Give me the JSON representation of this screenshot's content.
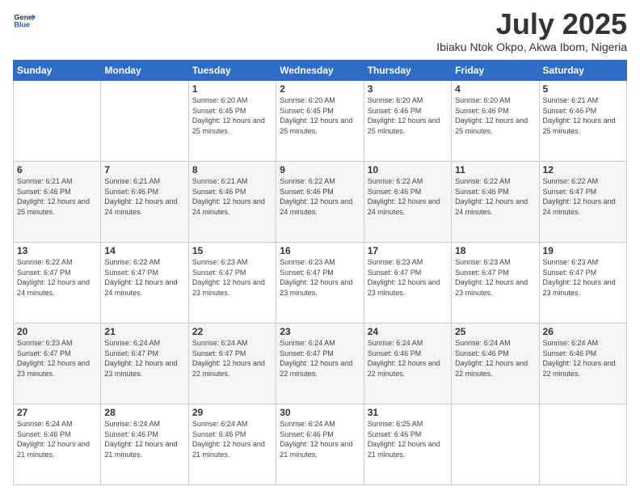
{
  "header": {
    "logo": {
      "general": "General",
      "blue": "Blue"
    },
    "title": "July 2025",
    "location": "Ibiaku Ntok Okpo, Akwa Ibom, Nigeria"
  },
  "weekdays": [
    "Sunday",
    "Monday",
    "Tuesday",
    "Wednesday",
    "Thursday",
    "Friday",
    "Saturday"
  ],
  "weeks": [
    [
      {
        "day": "",
        "info": ""
      },
      {
        "day": "",
        "info": ""
      },
      {
        "day": "1",
        "info": "Sunrise: 6:20 AM\nSunset: 6:45 PM\nDaylight: 12 hours and 25 minutes."
      },
      {
        "day": "2",
        "info": "Sunrise: 6:20 AM\nSunset: 6:45 PM\nDaylight: 12 hours and 25 minutes."
      },
      {
        "day": "3",
        "info": "Sunrise: 6:20 AM\nSunset: 6:46 PM\nDaylight: 12 hours and 25 minutes."
      },
      {
        "day": "4",
        "info": "Sunrise: 6:20 AM\nSunset: 6:46 PM\nDaylight: 12 hours and 25 minutes."
      },
      {
        "day": "5",
        "info": "Sunrise: 6:21 AM\nSunset: 6:46 PM\nDaylight: 12 hours and 25 minutes."
      }
    ],
    [
      {
        "day": "6",
        "info": "Sunrise: 6:21 AM\nSunset: 6:46 PM\nDaylight: 12 hours and 25 minutes."
      },
      {
        "day": "7",
        "info": "Sunrise: 6:21 AM\nSunset: 6:46 PM\nDaylight: 12 hours and 24 minutes."
      },
      {
        "day": "8",
        "info": "Sunrise: 6:21 AM\nSunset: 6:46 PM\nDaylight: 12 hours and 24 minutes."
      },
      {
        "day": "9",
        "info": "Sunrise: 6:22 AM\nSunset: 6:46 PM\nDaylight: 12 hours and 24 minutes."
      },
      {
        "day": "10",
        "info": "Sunrise: 6:22 AM\nSunset: 6:46 PM\nDaylight: 12 hours and 24 minutes."
      },
      {
        "day": "11",
        "info": "Sunrise: 6:22 AM\nSunset: 6:46 PM\nDaylight: 12 hours and 24 minutes."
      },
      {
        "day": "12",
        "info": "Sunrise: 6:22 AM\nSunset: 6:47 PM\nDaylight: 12 hours and 24 minutes."
      }
    ],
    [
      {
        "day": "13",
        "info": "Sunrise: 6:22 AM\nSunset: 6:47 PM\nDaylight: 12 hours and 24 minutes."
      },
      {
        "day": "14",
        "info": "Sunrise: 6:22 AM\nSunset: 6:47 PM\nDaylight: 12 hours and 24 minutes."
      },
      {
        "day": "15",
        "info": "Sunrise: 6:23 AM\nSunset: 6:47 PM\nDaylight: 12 hours and 23 minutes."
      },
      {
        "day": "16",
        "info": "Sunrise: 6:23 AM\nSunset: 6:47 PM\nDaylight: 12 hours and 23 minutes."
      },
      {
        "day": "17",
        "info": "Sunrise: 6:23 AM\nSunset: 6:47 PM\nDaylight: 12 hours and 23 minutes."
      },
      {
        "day": "18",
        "info": "Sunrise: 6:23 AM\nSunset: 6:47 PM\nDaylight: 12 hours and 23 minutes."
      },
      {
        "day": "19",
        "info": "Sunrise: 6:23 AM\nSunset: 6:47 PM\nDaylight: 12 hours and 23 minutes."
      }
    ],
    [
      {
        "day": "20",
        "info": "Sunrise: 6:23 AM\nSunset: 6:47 PM\nDaylight: 12 hours and 23 minutes."
      },
      {
        "day": "21",
        "info": "Sunrise: 6:24 AM\nSunset: 6:47 PM\nDaylight: 12 hours and 23 minutes."
      },
      {
        "day": "22",
        "info": "Sunrise: 6:24 AM\nSunset: 6:47 PM\nDaylight: 12 hours and 22 minutes."
      },
      {
        "day": "23",
        "info": "Sunrise: 6:24 AM\nSunset: 6:47 PM\nDaylight: 12 hours and 22 minutes."
      },
      {
        "day": "24",
        "info": "Sunrise: 6:24 AM\nSunset: 6:46 PM\nDaylight: 12 hours and 22 minutes."
      },
      {
        "day": "25",
        "info": "Sunrise: 6:24 AM\nSunset: 6:46 PM\nDaylight: 12 hours and 22 minutes."
      },
      {
        "day": "26",
        "info": "Sunrise: 6:24 AM\nSunset: 6:46 PM\nDaylight: 12 hours and 22 minutes."
      }
    ],
    [
      {
        "day": "27",
        "info": "Sunrise: 6:24 AM\nSunset: 6:46 PM\nDaylight: 12 hours and 21 minutes."
      },
      {
        "day": "28",
        "info": "Sunrise: 6:24 AM\nSunset: 6:46 PM\nDaylight: 12 hours and 21 minutes."
      },
      {
        "day": "29",
        "info": "Sunrise: 6:24 AM\nSunset: 6:46 PM\nDaylight: 12 hours and 21 minutes."
      },
      {
        "day": "30",
        "info": "Sunrise: 6:24 AM\nSunset: 6:46 PM\nDaylight: 12 hours and 21 minutes."
      },
      {
        "day": "31",
        "info": "Sunrise: 6:25 AM\nSunset: 6:46 PM\nDaylight: 12 hours and 21 minutes."
      },
      {
        "day": "",
        "info": ""
      },
      {
        "day": "",
        "info": ""
      }
    ]
  ]
}
